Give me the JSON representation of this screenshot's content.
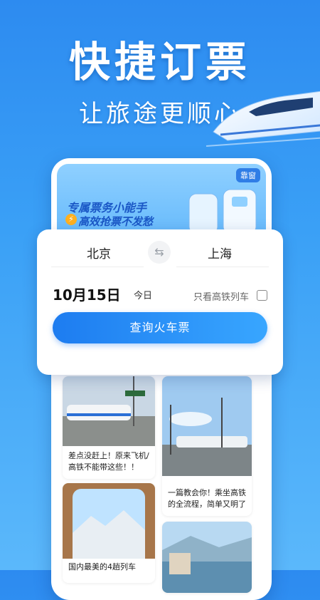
{
  "hero": {
    "title": "快捷订票",
    "subtitle": "让旅途更顺心"
  },
  "banner": {
    "tag": "靠窗",
    "title": "专属票务小能手",
    "subtitle": "高效抢票不发愁"
  },
  "search": {
    "from_city": "北京",
    "to_city": "上海",
    "swap_icon": "swap-icon",
    "date": "10月15日",
    "day_label": "今日",
    "high_speed_label": "只看高铁列车",
    "high_speed_checked": false,
    "button_label": "查询火车票"
  },
  "feed": [
    {
      "text": "差点没赶上！原来飞机/高铁不能带这些！！"
    },
    {
      "text": "一篇教会你！乘坐高铁的全流程，简单又明了"
    },
    {
      "text": "国内最美的4趟列车"
    }
  ],
  "colors": {
    "brand_blue": "#1d7cf0",
    "background": "#2d8bf0"
  }
}
